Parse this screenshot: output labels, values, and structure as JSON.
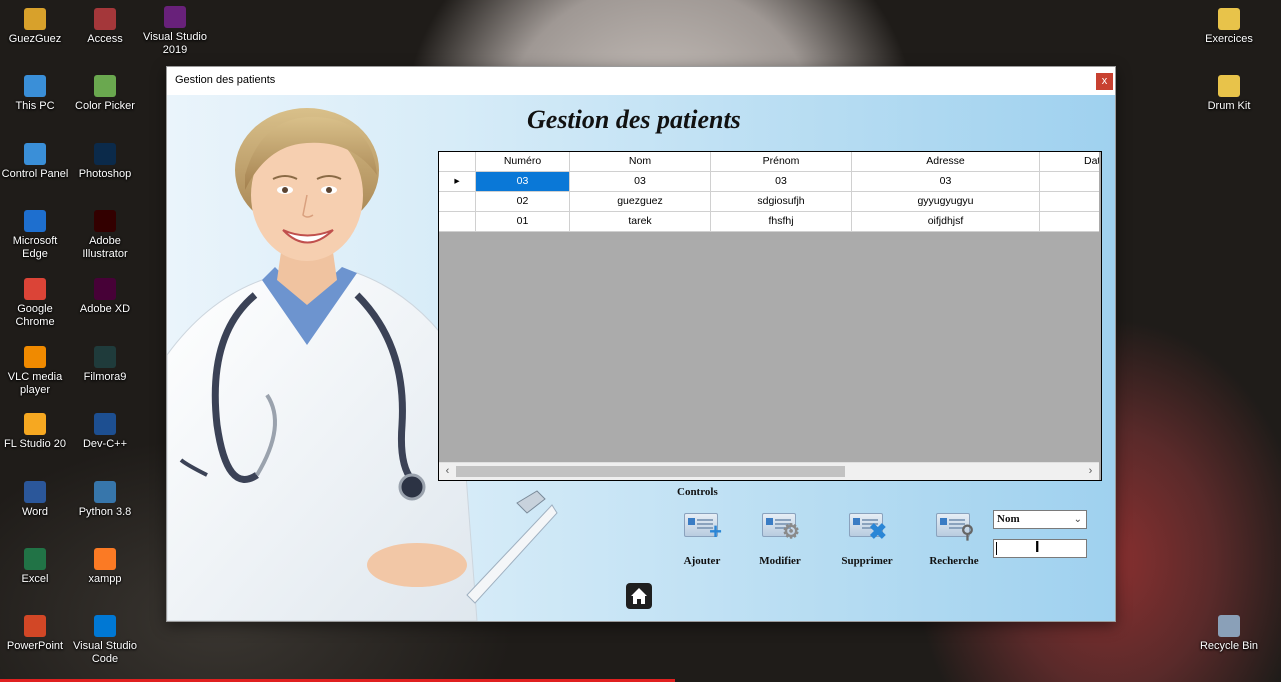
{
  "desktop": {
    "icons_left_col1": [
      {
        "label": "GuezGuez",
        "icon": "user-folder-icon",
        "color": "#d8a12b"
      },
      {
        "label": "This PC",
        "icon": "computer-icon",
        "color": "#3a8fd8"
      },
      {
        "label": "Control Panel",
        "icon": "control-panel-icon",
        "color": "#3a8fd8"
      },
      {
        "label": "Microsoft Edge",
        "icon": "edge-icon",
        "color": "#1e6fcf"
      },
      {
        "label": "Google Chrome",
        "icon": "chrome-icon",
        "color": "#db4437"
      },
      {
        "label": "VLC media player",
        "icon": "vlc-icon",
        "color": "#f08a00"
      },
      {
        "label": "FL Studio 20",
        "icon": "fl-studio-icon",
        "color": "#f6a821"
      },
      {
        "label": "Word",
        "icon": "word-icon",
        "color": "#2b579a"
      },
      {
        "label": "Excel",
        "icon": "excel-icon",
        "color": "#217346"
      },
      {
        "label": "PowerPoint",
        "icon": "powerpoint-icon",
        "color": "#d24726"
      }
    ],
    "icons_left_col2": [
      {
        "label": "Access",
        "icon": "access-icon",
        "color": "#a4373a"
      },
      {
        "label": "Color Picker",
        "icon": "color-picker-icon",
        "color": "#6aa84f"
      },
      {
        "label": "Photoshop",
        "icon": "photoshop-icon",
        "color": "#0b2a4a"
      },
      {
        "label": "Adobe Illustrator",
        "icon": "illustrator-icon",
        "color": "#330000"
      },
      {
        "label": "Adobe XD",
        "icon": "adobe-xd-icon",
        "color": "#470137"
      },
      {
        "label": "Filmora9",
        "icon": "filmora-icon",
        "color": "#1f3b3b"
      },
      {
        "label": "Dev-C++",
        "icon": "dev-cpp-icon",
        "color": "#1d4f91"
      },
      {
        "label": "Python 3.8",
        "icon": "python-icon",
        "color": "#3776ab"
      },
      {
        "label": "xampp",
        "icon": "xampp-icon",
        "color": "#fb7a24"
      },
      {
        "label": "Visual Studio Code",
        "icon": "vscode-icon",
        "color": "#0078d4"
      }
    ],
    "icons_left_col3": [
      {
        "label": "Visual Studio 2019",
        "icon": "visual-studio-icon",
        "color": "#68217a"
      }
    ],
    "icons_right": [
      {
        "label": "Exercices",
        "icon": "folder-icon",
        "color": "#e8c34a"
      },
      {
        "label": "Drum Kit",
        "icon": "drum-kit-icon",
        "color": "#e8c34a"
      },
      {
        "label": "Recycle Bin",
        "icon": "recycle-bin-icon",
        "color": "#8aa0b8"
      }
    ]
  },
  "window": {
    "title": "Gestion des patients",
    "close_label": "x",
    "heading": "Gestion des patients",
    "grid": {
      "columns": [
        "Numéro",
        "Nom",
        "Prénom",
        "Adresse",
        "Dat"
      ],
      "rows": [
        [
          "03",
          "03",
          "03",
          "03",
          ""
        ],
        [
          "02",
          "guezguez",
          "sdgiosufjh",
          "gyyugyugyu",
          ""
        ],
        [
          "01",
          "tarek",
          "fhsfhj",
          "oifjdhjsf",
          ""
        ]
      ],
      "current_row_marker": "▸"
    },
    "controls_label": "Controls",
    "buttons": {
      "ajouter": "Ajouter",
      "modifier": "Modifier",
      "supprimer": "Supprimer",
      "recherche": "Recherche"
    },
    "search": {
      "field_selected": "Nom",
      "value": ""
    }
  }
}
